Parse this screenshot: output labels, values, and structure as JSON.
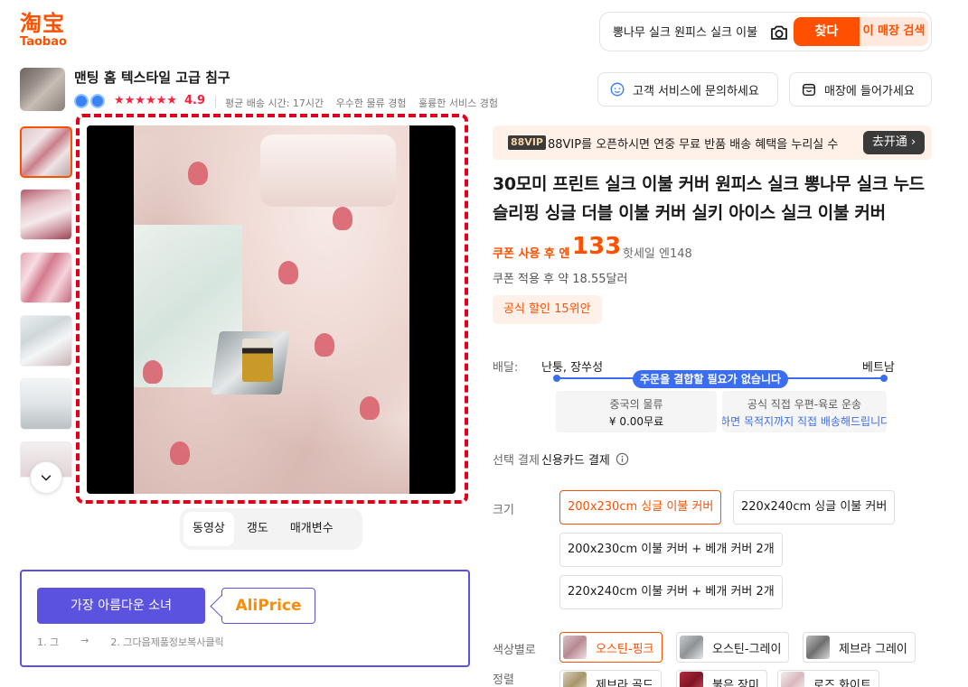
{
  "logo": {
    "cn": "淘宝",
    "en": "Taobao"
  },
  "search": {
    "value": "뽕나무 실크 원피스 실크 이불",
    "search_label": "찾다",
    "store_search_label": "이 매장 검색"
  },
  "shop": {
    "name": "맨팅 홈 텍스타일 고급 침구",
    "stars": "★★★★★★",
    "rating": "4.9",
    "meta": [
      "평균 배송 시간: 17시간",
      "우수한 물류 경험",
      "훌륭한 서비스 경험"
    ],
    "cs_label": "고객 서비스에 문의하세요",
    "store_label": "매장에 들어가세요"
  },
  "media_tabs": [
    "동영상",
    "갱도",
    "매개변수"
  ],
  "aliprice": {
    "button": "가장 아름다운 소녀",
    "logo": "AliPrice",
    "step1": "1. 그",
    "arrow": "→",
    "step2": "2. 그다음제품정보복사클릭"
  },
  "vip": {
    "tag": "88VIP",
    "text": "88VIP를 오픈하시면 연중 무료 반품 배송 혜택을 누리실 수",
    "button": "去开通 ›"
  },
  "product": {
    "title": "30모미 프린트 실크 이불 커버 원피스 실크 뽕나무 실크 누드 슬리핑 싱글 더블 이불 커버 실키 아이스 실크 이불 커버",
    "price_label": "쿠폰 사용 후 엔",
    "price": "133",
    "orig_price": "핫세일 엔148",
    "usd": "쿠폰 적용 후 약 18.55달러",
    "coupon": "공식 할인 15위안"
  },
  "shipping": {
    "label": "배달:",
    "from": "난퉁, 장쑤성",
    "to": "베트남",
    "note": "주문을 결합할 필요가 없습니다",
    "card1_l1": "중국의 물류",
    "card1_l2": "¥ 0.00무료",
    "card2_l1": "공식 직접 우편-육로 운송",
    "card2_l2": "주문하면 목적지까지 직접 배송해드립니다"
  },
  "payment": {
    "label": "선택 결제",
    "value": "신용카드 결제"
  },
  "sizes": {
    "label": "크기",
    "options": [
      "200x230cm 싱글 이불 커버",
      "220x240cm 싱글 이불 커버",
      "200x230cm 이불 커버 + 베개 커버 2개",
      "220x240cm 이불 커버 + 베개 커버 2개"
    ]
  },
  "colors": {
    "label": "색상별로 정렬",
    "label1": "색상별로",
    "label2": "정렬",
    "options": [
      "오스틴-핑크",
      "오스틴-그레이",
      "제브라 그레이",
      "제브라 골드",
      "붉은 장미",
      "로즈 화이트"
    ]
  },
  "colors_hex": {
    "accent": "#ff5000",
    "ali": "#5b53e0",
    "ship_blue": "#3b6df0",
    "frame_red": "#e0001b"
  }
}
